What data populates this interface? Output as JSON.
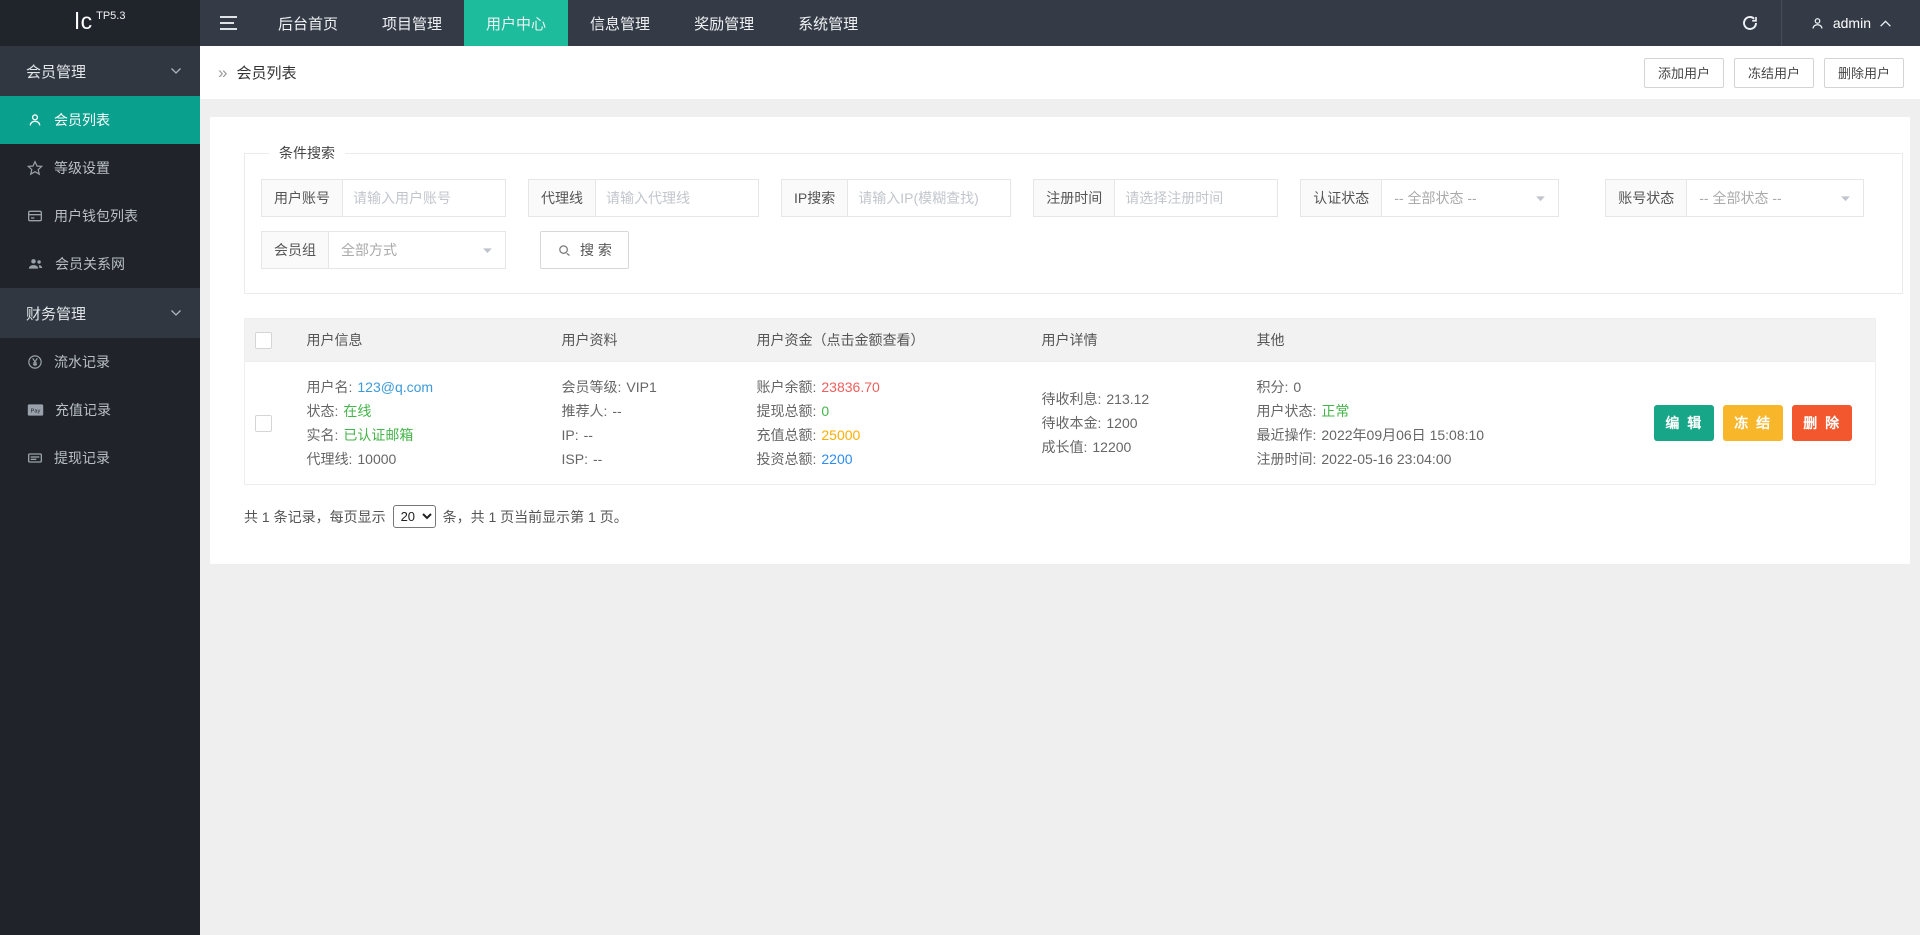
{
  "theme": {
    "topbar_active": "#1cbc9c",
    "sidebar_active": "#09a18e"
  },
  "topbar": {
    "logo": "lc",
    "logo_version": "TP5.3",
    "nav_items": [
      {
        "label": "后台首页"
      },
      {
        "label": "项目管理"
      },
      {
        "label": "用户中心"
      },
      {
        "label": "信息管理"
      },
      {
        "label": "奖励管理"
      },
      {
        "label": "系统管理"
      }
    ],
    "username": "admin"
  },
  "sidebar": {
    "groups": [
      {
        "label": "会员管理",
        "items": [
          {
            "label": "会员列表",
            "icon": "user-icon",
            "active": true
          },
          {
            "label": "等级设置",
            "icon": "star-icon"
          },
          {
            "label": "用户钱包列表",
            "icon": "wallet-icon"
          },
          {
            "label": "会员关系网",
            "icon": "people-icon"
          }
        ]
      },
      {
        "label": "财务管理",
        "items": [
          {
            "label": "流水记录",
            "icon": "yen-circle-icon"
          },
          {
            "label": "充值记录",
            "icon": "paypal-icon"
          },
          {
            "label": "提现记录",
            "icon": "card-icon"
          }
        ]
      }
    ]
  },
  "breadcrumb": {
    "icon": "»",
    "title": "会员列表"
  },
  "toolbar": {
    "buttons": [
      {
        "label": "添加用户"
      },
      {
        "label": "冻结用户"
      },
      {
        "label": "删除用户"
      }
    ]
  },
  "search": {
    "legend": "条件搜索",
    "fields": [
      {
        "label": "用户账号",
        "placeholder": "请输入用户账号"
      },
      {
        "label": "代理线",
        "placeholder": "请输入代理线"
      },
      {
        "label": "IP搜索",
        "placeholder": "请输入IP(模糊查找)"
      },
      {
        "label": "注册时间",
        "placeholder": "请选择注册时间"
      },
      {
        "label": "认证状态",
        "value": "-- 全部状态 --"
      },
      {
        "label": "账号状态",
        "value": "-- 全部状态 --"
      },
      {
        "label": "会员组",
        "value": "全部方式"
      }
    ],
    "button": "搜 索"
  },
  "table": {
    "headers": [
      "用户信息",
      "用户资料",
      "用户资金（点击金额查看）",
      "用户详情",
      "其他"
    ],
    "row": {
      "info": [
        {
          "label": "用户名:",
          "value": "123@q.com",
          "color": "#3d9ad9"
        },
        {
          "label": "状态:",
          "value": "在线",
          "color": "#44b549"
        },
        {
          "label": "实名:",
          "value": "已认证邮箱",
          "color": "#44b549"
        },
        {
          "label": "代理线:",
          "value": "10000"
        }
      ],
      "profile": [
        {
          "label": "会员等级:",
          "value": "VIP1"
        },
        {
          "label": "推荐人:",
          "value": "--"
        },
        {
          "label": "IP:",
          "value": "--"
        },
        {
          "label": "ISP:",
          "value": "--"
        }
      ],
      "funds": [
        {
          "label": "账户余额:",
          "value": "23836.70",
          "color": "#ee5f5f"
        },
        {
          "label": "提现总额:",
          "value": "0",
          "color": "#44b549"
        },
        {
          "label": "充值总额:",
          "value": "25000",
          "color": "#ffae00"
        },
        {
          "label": "投资总额:",
          "value": "2200",
          "color": "#2d8cf0"
        }
      ],
      "details": [
        {
          "label": "待收利息:",
          "value": "213.12"
        },
        {
          "label": "待收本金:",
          "value": "1200"
        },
        {
          "label": "成长值:",
          "value": "12200"
        }
      ],
      "other": [
        {
          "label": "积分:",
          "value": "0"
        },
        {
          "label": "用户状态:",
          "value": "正常",
          "color": "#44b549"
        },
        {
          "label": "最近操作:",
          "value": "2022年09月06日 15:08:10"
        },
        {
          "label": "注册时间:",
          "value": "2022-05-16 23:04:00"
        }
      ],
      "actions": [
        {
          "label": "编 辑",
          "bg": "#18a689"
        },
        {
          "label": "冻 结",
          "bg": "#f8b62b"
        },
        {
          "label": "删 除",
          "bg": "#f2572d"
        }
      ]
    }
  },
  "pagination": {
    "prefix": "共 1 条记录，每页显示",
    "per_page": "20",
    "suffix": "条，共 1 页当前显示第 1 页。"
  }
}
